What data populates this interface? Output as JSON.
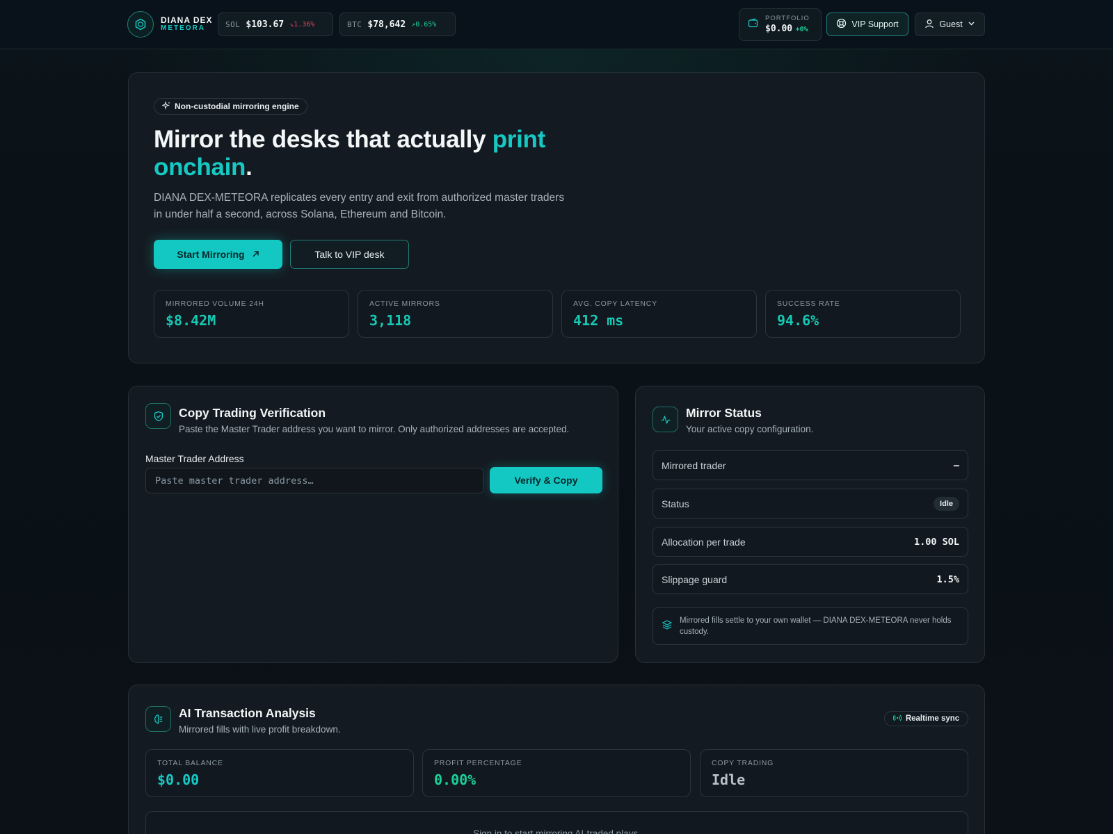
{
  "brand": {
    "name": "DIANA DEX",
    "sub": "METEORA"
  },
  "tickers": [
    {
      "symbol": "SOL",
      "price": "$103.67",
      "change": "↘1.36%",
      "direction": "down"
    },
    {
      "symbol": "BTC",
      "price": "$78,642",
      "change": "↗0.65%",
      "direction": "up"
    }
  ],
  "portfolio": {
    "label": "PORTFOLIO",
    "value": "$0.00",
    "change": "+0%"
  },
  "header": {
    "vip_label": "VIP Support",
    "guest_label": "Guest"
  },
  "hero": {
    "pill": "Non-custodial mirroring engine",
    "title_main": "Mirror the desks that actually ",
    "title_accent": "print onchain",
    "title_end": ".",
    "lead": "DIANA DEX-METEORA replicates every entry and exit from authorized master traders in under half a second, across Solana, Ethereum and Bitcoin.",
    "primary_cta": "Start Mirroring",
    "secondary_cta": "Talk to VIP desk",
    "stats": [
      {
        "label": "MIRRORED VOLUME 24H",
        "value": "$8.42M"
      },
      {
        "label": "ACTIVE MIRRORS",
        "value": "3,118"
      },
      {
        "label": "AVG. COPY LATENCY",
        "value": "412 ms"
      },
      {
        "label": "SUCCESS RATE",
        "value": "94.6%"
      }
    ]
  },
  "verify": {
    "title": "Copy Trading Verification",
    "subtitle": "Paste the Master Trader address you want to mirror. Only authorized addresses are accepted.",
    "field_label": "Master Trader Address",
    "placeholder": "Paste master trader address…",
    "value": "",
    "button": "Verify & Copy"
  },
  "mirror_status": {
    "title": "Mirror Status",
    "subtitle": "Your active copy configuration.",
    "rows": [
      {
        "label": "Mirrored trader",
        "value": "–"
      },
      {
        "label": "Status",
        "value": "Idle"
      },
      {
        "label": "Allocation per trade",
        "value": "1.00 SOL"
      },
      {
        "label": "Slippage guard",
        "value": "1.5%"
      }
    ],
    "note": "Mirrored fills settle to your own wallet — DIANA DEX-METEORA never holds custody."
  },
  "ai": {
    "title": "AI Transaction Analysis",
    "subtitle": "Mirrored fills with live profit breakdown.",
    "badge": "Realtime sync",
    "stats": [
      {
        "label": "TOTAL BALANCE",
        "value": "$0.00"
      },
      {
        "label": "PROFIT PERCENTAGE",
        "value": "0.00%"
      },
      {
        "label": "COPY TRADING",
        "value": "Idle"
      }
    ],
    "empty_text": "Sign in to start mirroring AI-traded plays."
  },
  "colors": {
    "accent": "#13c8c2",
    "positive": "#1bd19a",
    "negative": "#e0455a",
    "background": "#0b1116"
  }
}
